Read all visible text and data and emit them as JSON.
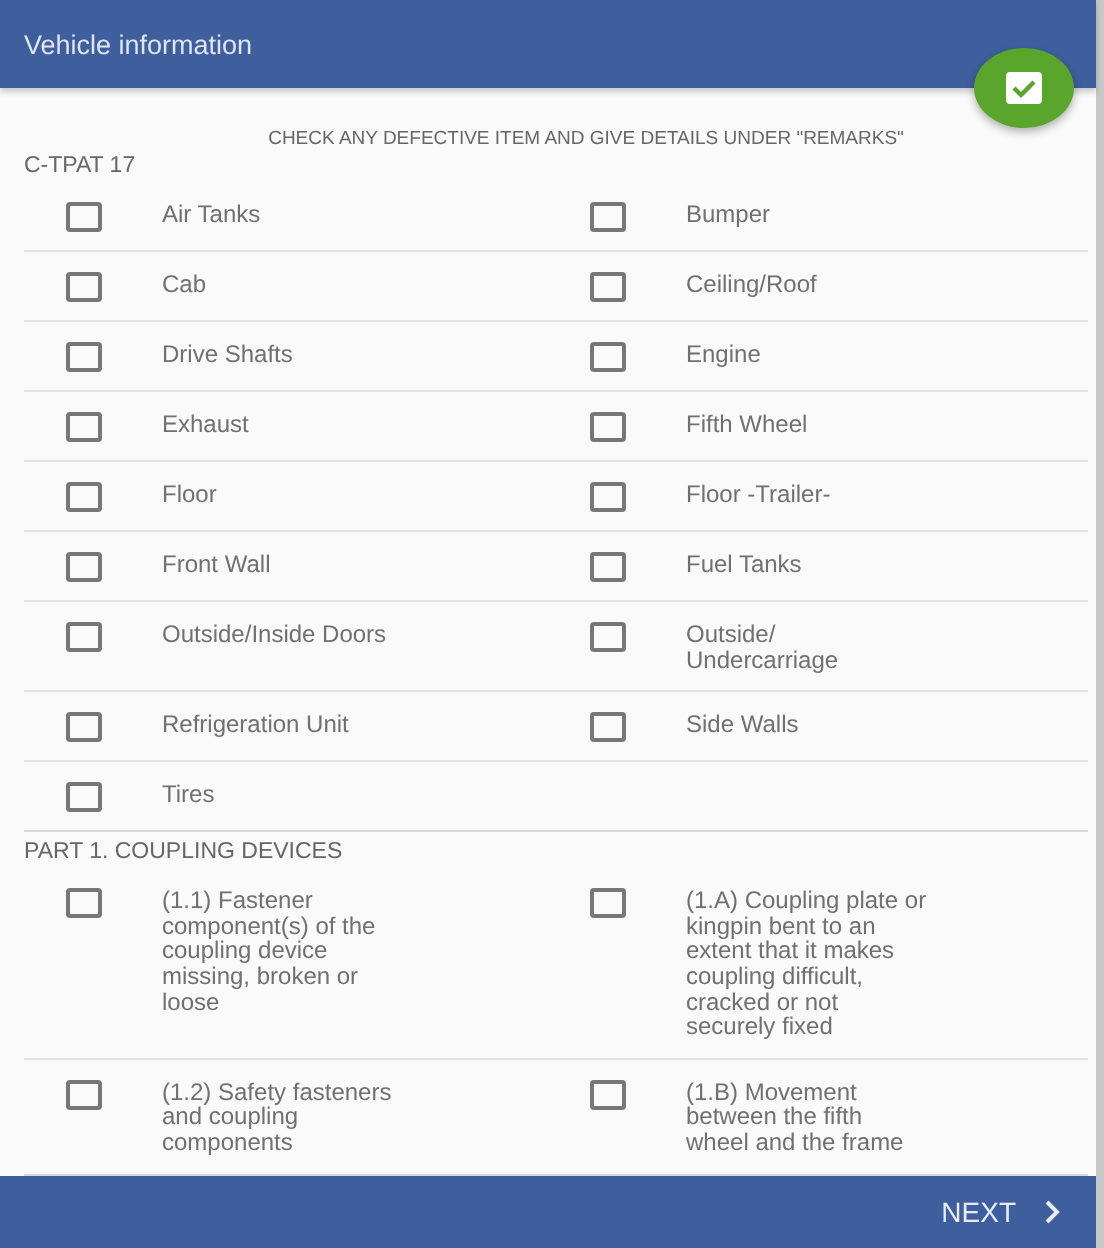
{
  "header": {
    "title": "Vehicle information"
  },
  "instruction": "CHECK ANY DEFECTIVE ITEM AND GIVE DETAILS UNDER \"REMARKS\"",
  "sections": [
    {
      "title": "C-TPAT 17",
      "rows": [
        [
          {
            "label": "Air Tanks",
            "checked": false
          },
          {
            "label": "Bumper",
            "checked": false
          }
        ],
        [
          {
            "label": "Cab",
            "checked": false
          },
          {
            "label": "Ceiling/Roof",
            "checked": false
          }
        ],
        [
          {
            "label": "Drive Shafts",
            "checked": false
          },
          {
            "label": "Engine",
            "checked": false
          }
        ],
        [
          {
            "label": "Exhaust",
            "checked": false
          },
          {
            "label": "Fifth Wheel",
            "checked": false
          }
        ],
        [
          {
            "label": "Floor",
            "checked": false
          },
          {
            "label": "Floor -Trailer-",
            "checked": false
          }
        ],
        [
          {
            "label": "Front Wall",
            "checked": false
          },
          {
            "label": "Fuel Tanks",
            "checked": false
          }
        ],
        [
          {
            "label": "Outside/Inside Doors",
            "checked": false
          },
          {
            "label": "Outside/ Undercarriage",
            "checked": false
          }
        ],
        [
          {
            "label": "Refrigeration Unit",
            "checked": false
          },
          {
            "label": "Side Walls",
            "checked": false
          }
        ],
        [
          {
            "label": "Tires",
            "checked": false
          }
        ]
      ]
    },
    {
      "title": "PART 1. COUPLING DEVICES",
      "rows": [
        [
          {
            "label": "(1.1) Fastener component(s) of the coupling device missing, broken or loose",
            "checked": false
          },
          {
            "label": "(1.A) Coupling plate or kingpin bent to an extent that it makes coupling difficult, cracked or not securely fixed",
            "checked": false
          }
        ],
        [
          {
            "label": "(1.2) Safety fasteners and coupling components",
            "checked": false
          },
          {
            "label": "(1.B) Movement between the fifth wheel and the frame",
            "checked": false
          }
        ]
      ]
    }
  ],
  "footer": {
    "next": "NEXT"
  }
}
